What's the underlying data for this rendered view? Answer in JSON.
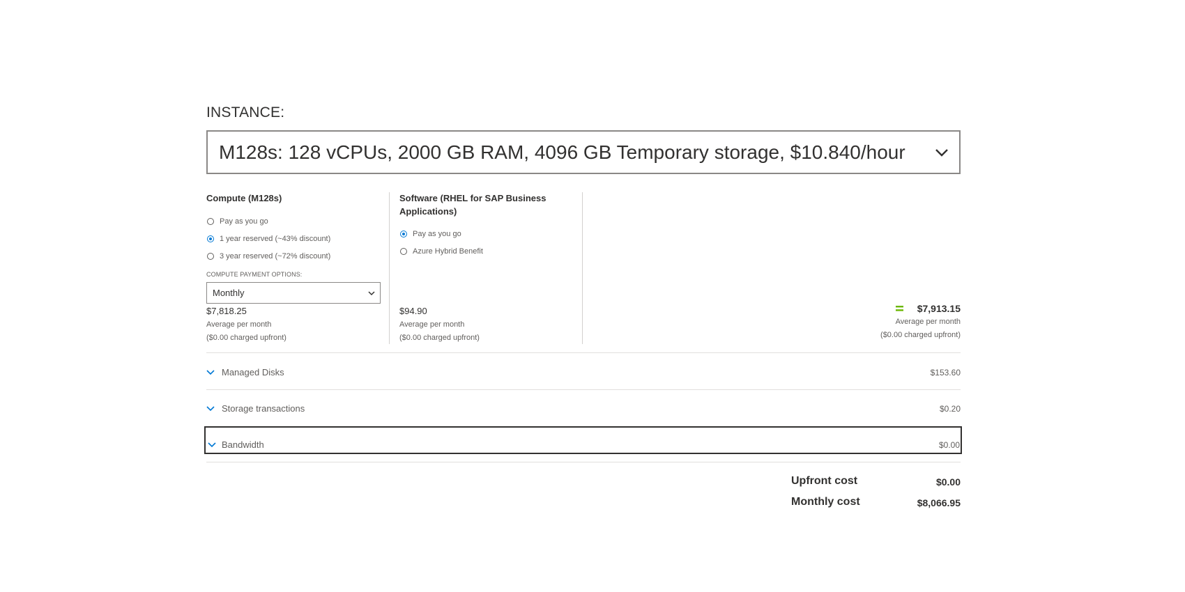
{
  "instance": {
    "label": "INSTANCE:",
    "selected": "M128s: 128 vCPUs, 2000 GB RAM, 4096 GB Temporary storage, $10.840/hour",
    "chevron_icon": "chevron-down-icon"
  },
  "compute": {
    "title": "Compute (M128s)",
    "options": [
      {
        "label": "Pay as you go",
        "checked": false
      },
      {
        "label": "1 year reserved (~43% discount)",
        "checked": true
      },
      {
        "label": "3 year reserved (~72% discount)",
        "checked": false
      }
    ],
    "payment_options_label": "COMPUTE PAYMENT OPTIONS:",
    "payment_option_selected": "Monthly",
    "price": "$7,818.25",
    "price_note": "Average per month",
    "upfront_note": "($0.00 charged upfront)"
  },
  "software": {
    "title": "Software (RHEL for SAP Business Applications)",
    "options": [
      {
        "label": "Pay as you go",
        "checked": true
      },
      {
        "label": "Azure Hybrid Benefit",
        "checked": false
      }
    ],
    "price": "$94.90",
    "price_note": "Average per month",
    "upfront_note": "($0.00 charged upfront)"
  },
  "total": {
    "icon": "equals-icon",
    "price": "$7,913.15",
    "price_note": "Average per month",
    "upfront_note": "($0.00 charged upfront)"
  },
  "sections": [
    {
      "label": "Managed Disks",
      "value": "$153.60"
    },
    {
      "label": "Storage transactions",
      "value": "$0.20"
    },
    {
      "label": "Bandwidth",
      "value": "$0.00"
    }
  ],
  "summary": {
    "upfront_label": "Upfront cost",
    "upfront_value": "$0.00",
    "monthly_label": "Monthly cost",
    "monthly_value": "$8,066.95"
  },
  "colors": {
    "accent": "#0078d4",
    "equals": "#6bb700",
    "text": "#323130",
    "muted": "#605e5c"
  }
}
